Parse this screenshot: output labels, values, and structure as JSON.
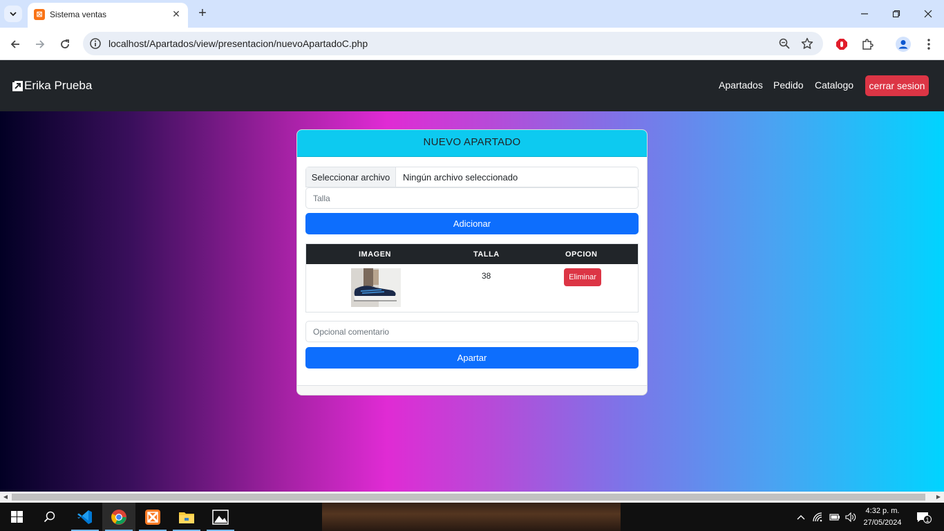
{
  "browser": {
    "tab_title": "Sistema ventas",
    "tab_close": "✕",
    "new_tab": "+",
    "url": "localhost/Apartados/view/presentacion/nuevoApartadoC.php"
  },
  "navbar": {
    "brand": "Erika Prueba",
    "links": [
      "Apartados",
      "Pedido",
      "Catalogo"
    ],
    "logout": "cerrar sesion"
  },
  "card": {
    "title": "NUEVO APARTADO",
    "file_button": "Seleccionar archivo",
    "file_status": "Ningún archivo seleccionado",
    "size_placeholder": "Talla",
    "add_button": "Adicionar",
    "table": {
      "headers": [
        "IMAGEN",
        "TALLA",
        "OPCION"
      ],
      "rows": [
        {
          "image": "shoe-photo",
          "talla": "38",
          "action": "Eliminar"
        }
      ]
    },
    "comment_placeholder": "Opcional comentario",
    "submit_button": "Apartar"
  },
  "taskbar": {
    "time": "4:32 p. m.",
    "date": "27/05/2024",
    "notification_count": "1"
  },
  "colors": {
    "navbar": "#212529",
    "header": "#0dcaf0",
    "primary": "#0d6efd",
    "danger": "#dc3545"
  }
}
